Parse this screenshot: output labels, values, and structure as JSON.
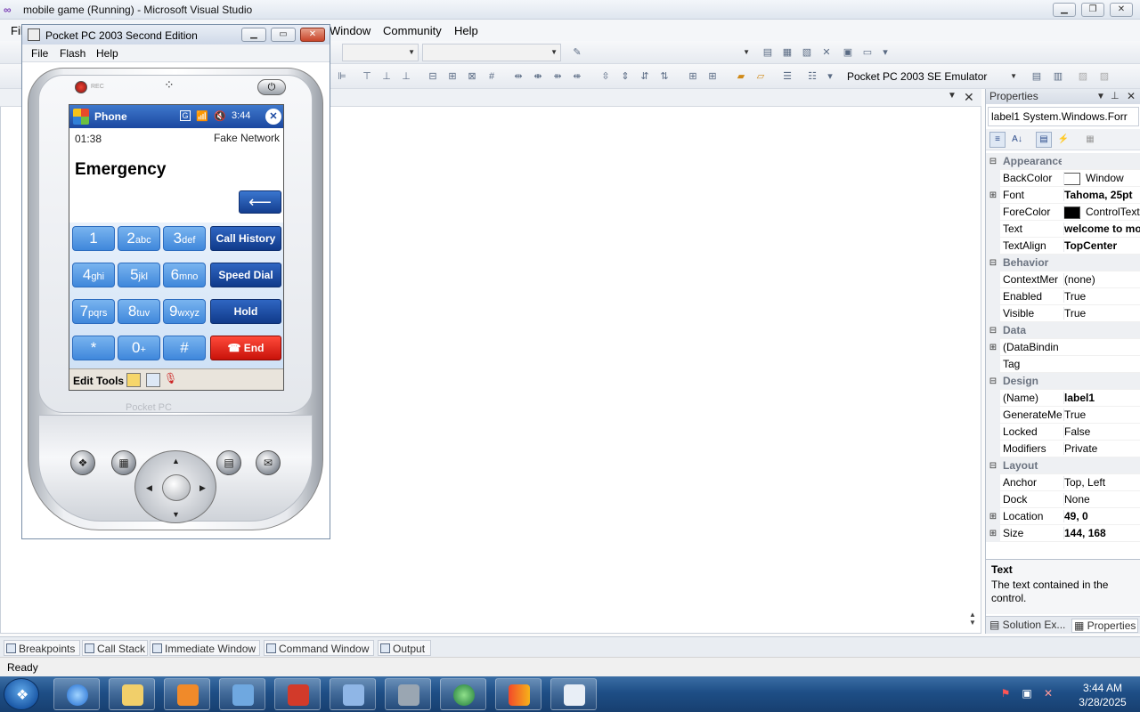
{
  "vs": {
    "title": "mobile game (Running) - Microsoft Visual Studio",
    "menu": [
      "Window",
      "Community",
      "Help"
    ],
    "menu_partial": "Fil",
    "target_device": "Pocket PC 2003 SE Emulator",
    "status": "Ready",
    "minimize": "▁",
    "restore": "❐",
    "close": "✕",
    "doc_close": "✕"
  },
  "properties": {
    "header": "Properties",
    "object": "label1  System.Windows.Forr",
    "rows": [
      {
        "type": "cat",
        "name": "Appearance",
        "expand": "⊟"
      },
      {
        "type": "prop",
        "name": "BackColor",
        "value": "Window",
        "swatch": "#ffffff"
      },
      {
        "type": "prop",
        "name": "Font",
        "value": "Tahoma, 25pt",
        "bold": true,
        "expand": "⊞"
      },
      {
        "type": "prop",
        "name": "ForeColor",
        "value": "ControlText",
        "swatch": "#000000"
      },
      {
        "type": "prop",
        "name": "Text",
        "value": "welcome to mo",
        "bold": true
      },
      {
        "type": "prop",
        "name": "TextAlign",
        "value": "TopCenter",
        "bold": true
      },
      {
        "type": "cat",
        "name": "Behavior",
        "expand": "⊟"
      },
      {
        "type": "prop",
        "name": "ContextMer",
        "value": "(none)"
      },
      {
        "type": "prop",
        "name": "Enabled",
        "value": "True"
      },
      {
        "type": "prop",
        "name": "Visible",
        "value": "True"
      },
      {
        "type": "cat",
        "name": "Data",
        "expand": "⊟"
      },
      {
        "type": "prop",
        "name": "(DataBindin",
        "value": "",
        "expand": "⊞"
      },
      {
        "type": "prop",
        "name": "Tag",
        "value": ""
      },
      {
        "type": "cat",
        "name": "Design",
        "expand": "⊟"
      },
      {
        "type": "prop",
        "name": "(Name)",
        "value": "label1",
        "bold": true
      },
      {
        "type": "prop",
        "name": "GenerateMe",
        "value": "True"
      },
      {
        "type": "prop",
        "name": "Locked",
        "value": "False"
      },
      {
        "type": "prop",
        "name": "Modifiers",
        "value": "Private"
      },
      {
        "type": "cat",
        "name": "Layout",
        "expand": "⊟"
      },
      {
        "type": "prop",
        "name": "Anchor",
        "value": "Top, Left"
      },
      {
        "type": "prop",
        "name": "Dock",
        "value": "None"
      },
      {
        "type": "prop",
        "name": "Location",
        "value": "49, 0",
        "bold": true,
        "expand": "⊞"
      },
      {
        "type": "prop",
        "name": "Size",
        "value": "144, 168",
        "bold": true,
        "expand": "⊞"
      }
    ],
    "desc_title": "Text",
    "desc_text": "The text contained in the control.",
    "tab_solution": "Solution Ex...",
    "tab_properties": "Properties"
  },
  "bottom_tabs": [
    "Breakpoints",
    "Call Stack",
    "Immediate Window",
    "Command Window",
    "Output"
  ],
  "taskbar": {
    "time": "3:44 AM",
    "date": "3/28/2025",
    "apps": [
      "ie-icon",
      "explorer-icon",
      "media-player-icon",
      "remote-desktop-icon",
      "toolbox-icon",
      "device-manager-icon",
      "tools-icon",
      "globe-icon",
      "visual-studio-icon",
      "emulator-icon"
    ]
  },
  "emulator": {
    "title": "Pocket PC 2003 Second Edition",
    "menu": [
      "File",
      "Flash",
      "Help"
    ],
    "device_logo": "Pocket PC"
  },
  "phone": {
    "title": "Phone",
    "clock": "3:44",
    "timer": "01:38",
    "network": "Fake Network",
    "heading": "Emergency",
    "back": "⟵",
    "keys": [
      {
        "main": "1",
        "sub": ""
      },
      {
        "main": "2",
        "sub": "abc"
      },
      {
        "main": "3",
        "sub": "def"
      },
      {
        "main": "4",
        "sub": "ghi"
      },
      {
        "main": "5",
        "sub": "jkl"
      },
      {
        "main": "6",
        "sub": "mno"
      },
      {
        "main": "7",
        "sub": "pqrs"
      },
      {
        "main": "8",
        "sub": "tuv"
      },
      {
        "main": "9",
        "sub": "wxyz"
      },
      {
        "main": "*",
        "sub": ""
      },
      {
        "main": "0",
        "sub": "+"
      },
      {
        "main": "#",
        "sub": ""
      }
    ],
    "call_history": "Call History",
    "speed_dial": "Speed Dial",
    "hold": "Hold",
    "end": "End",
    "bar_edit": "Edit",
    "bar_tools": "Tools"
  }
}
